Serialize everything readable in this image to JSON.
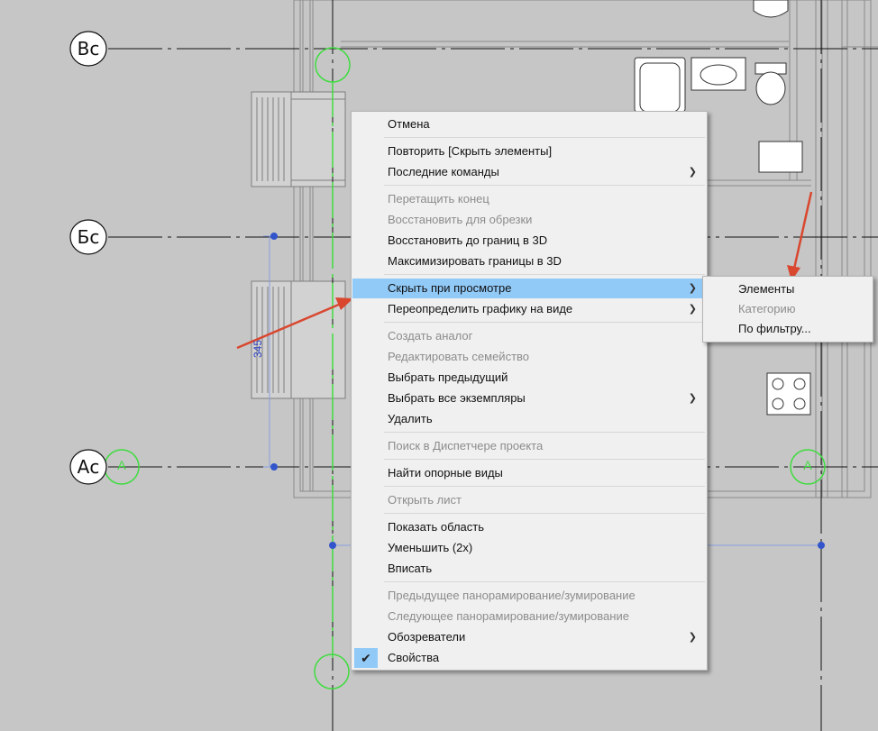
{
  "grid_labels": {
    "top": "Вс",
    "middle": "Бс",
    "bottom": "Ас"
  },
  "grid_circle_marks": {
    "lower_left": "А",
    "lower_right": "А"
  },
  "dimension_value": "345",
  "context_menu": {
    "items": [
      {
        "label": "Отмена",
        "disabled": false,
        "submenu": false
      },
      {
        "label": "Повторить [Скрыть элементы]",
        "disabled": false,
        "submenu": false
      },
      {
        "label": "Последние команды",
        "disabled": false,
        "submenu": true
      },
      {
        "label": "Перетащить конец",
        "disabled": true,
        "submenu": false
      },
      {
        "label": "Восстановить для обрезки",
        "disabled": true,
        "submenu": false
      },
      {
        "label": "Восстановить до границ в 3D",
        "disabled": false,
        "submenu": false
      },
      {
        "label": "Максимизировать границы в 3D",
        "disabled": false,
        "submenu": false
      },
      {
        "label": "Скрыть при просмотре",
        "disabled": false,
        "submenu": true,
        "highlighted": true
      },
      {
        "label": "Переопределить графику на виде",
        "disabled": false,
        "submenu": true
      },
      {
        "label": "Создать аналог",
        "disabled": true,
        "submenu": false
      },
      {
        "label": "Редактировать семейство",
        "disabled": true,
        "submenu": false
      },
      {
        "label": "Выбрать предыдущий",
        "disabled": false,
        "submenu": false
      },
      {
        "label": "Выбрать все экземпляры",
        "disabled": false,
        "submenu": true
      },
      {
        "label": "Удалить",
        "disabled": false,
        "submenu": false
      },
      {
        "label": "Поиск в Диспетчере проекта",
        "disabled": true,
        "submenu": false
      },
      {
        "label": "Найти опорные виды",
        "disabled": false,
        "submenu": false
      },
      {
        "label": "Открыть лист",
        "disabled": true,
        "submenu": false
      },
      {
        "label": "Показать область",
        "disabled": false,
        "submenu": false
      },
      {
        "label": "Уменьшить (2x)",
        "disabled": false,
        "submenu": false
      },
      {
        "label": "Вписать",
        "disabled": false,
        "submenu": false
      },
      {
        "label": "Предыдущее панорамирование/зумирование",
        "disabled": true,
        "submenu": false
      },
      {
        "label": "Следующее панорамирование/зумирование",
        "disabled": true,
        "submenu": false
      },
      {
        "label": "Обозреватели",
        "disabled": false,
        "submenu": true
      },
      {
        "label": "Свойства",
        "disabled": false,
        "submenu": false,
        "checked": true
      }
    ]
  },
  "sub_menu": {
    "items": [
      {
        "label": "Элементы",
        "disabled": false
      },
      {
        "label": "Категорию",
        "disabled": true
      },
      {
        "label": "По фильтру...",
        "disabled": false
      }
    ]
  },
  "icons": {
    "submenu_arrow": "chevron-right-icon",
    "checkmark": "check-icon"
  },
  "colors": {
    "background": "#c6c6c6",
    "menu_bg": "#f0f0f0",
    "highlight": "#91c9f7",
    "disabled_text": "#8c8c8c",
    "grid_green": "#3fdc3f",
    "dimension_blue": "#3355cc",
    "annotation_arrow": "#d9472f"
  }
}
